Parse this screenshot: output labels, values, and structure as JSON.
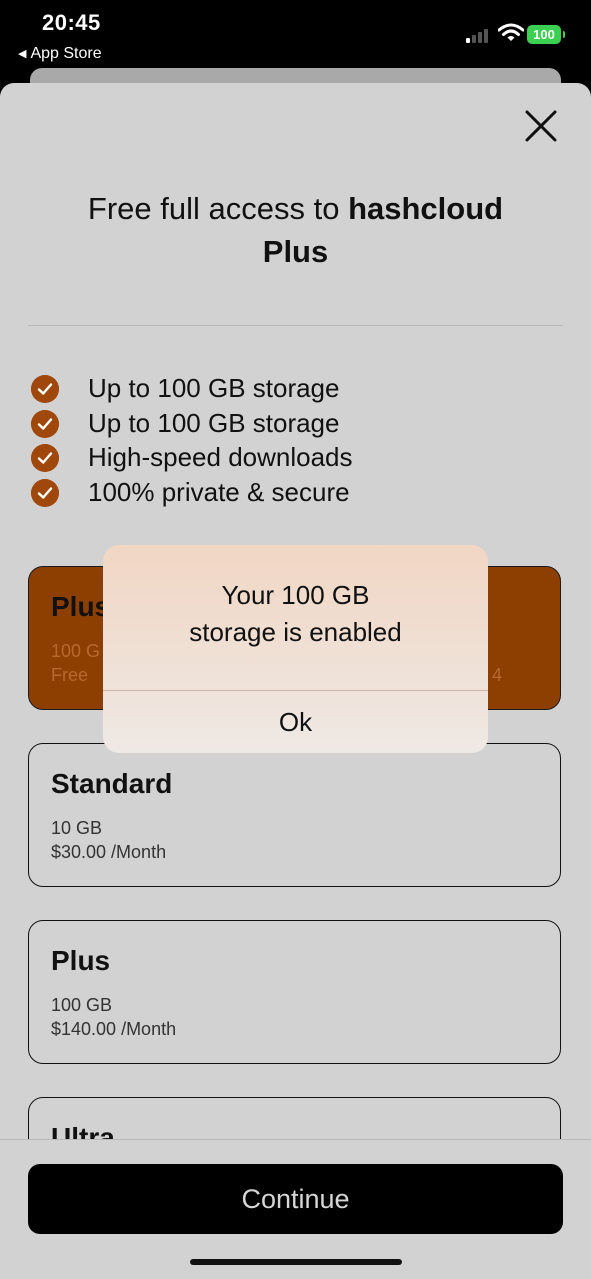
{
  "status_bar": {
    "time": "20:45",
    "back_label": "App Store",
    "battery": "100"
  },
  "paywall": {
    "title_prefix": "Free full access to ",
    "title_brand": "hashcloud",
    "title_suffix": "Plus",
    "features": [
      "Up to 100 GB storage",
      "Up to 100 GB storage",
      "High-speed downloads",
      "100% private & secure"
    ],
    "plans": [
      {
        "name": "Plus",
        "line1": "100 G",
        "line2": "Free",
        "right": "4",
        "selected": true
      },
      {
        "name": "Standard",
        "line1": "10 GB",
        "line2": "$30.00 /Month",
        "selected": false
      },
      {
        "name": "Plus",
        "line1": "100 GB",
        "line2": "$140.00 /Month",
        "selected": false
      },
      {
        "name": "Ultra",
        "selected": false
      }
    ],
    "continue_label": "Continue"
  },
  "alert": {
    "message_line1": "Your 100 GB",
    "message_line2": "storage is enabled",
    "ok_label": "Ok"
  },
  "colors": {
    "accent": "#a0480b",
    "selected_plan": "#8d3f02",
    "sheet": "#d2d2d2",
    "battery": "#3cd052"
  }
}
